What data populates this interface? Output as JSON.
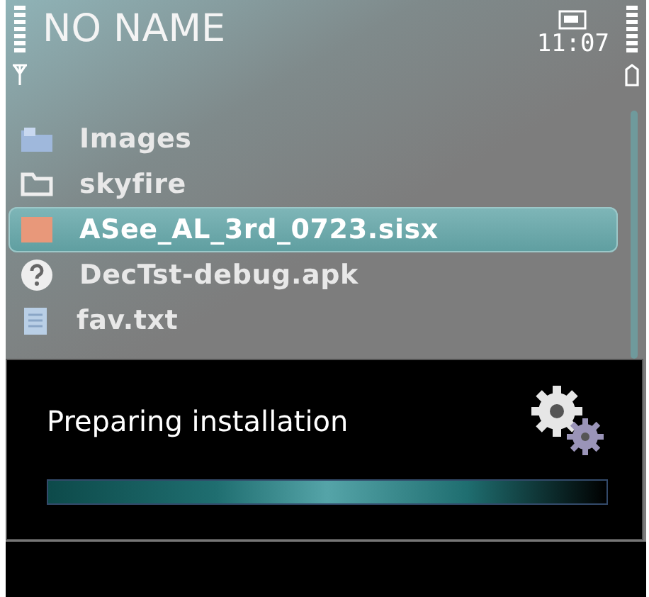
{
  "status_bar": {
    "title": "NO NAME",
    "time": "11:07"
  },
  "files": [
    {
      "kind": "images",
      "name": "Images",
      "selected": false
    },
    {
      "kind": "folder",
      "name": "skyfire",
      "selected": false
    },
    {
      "kind": "package",
      "name": "ASee_AL_3rd_0723.sisx",
      "selected": true
    },
    {
      "kind": "unknown",
      "name": "DecTst-debug.apk",
      "selected": false
    },
    {
      "kind": "text",
      "name": "fav.txt",
      "selected": false
    }
  ],
  "dialog": {
    "message": "Preparing installation",
    "progress": {
      "indeterminate": true
    }
  }
}
